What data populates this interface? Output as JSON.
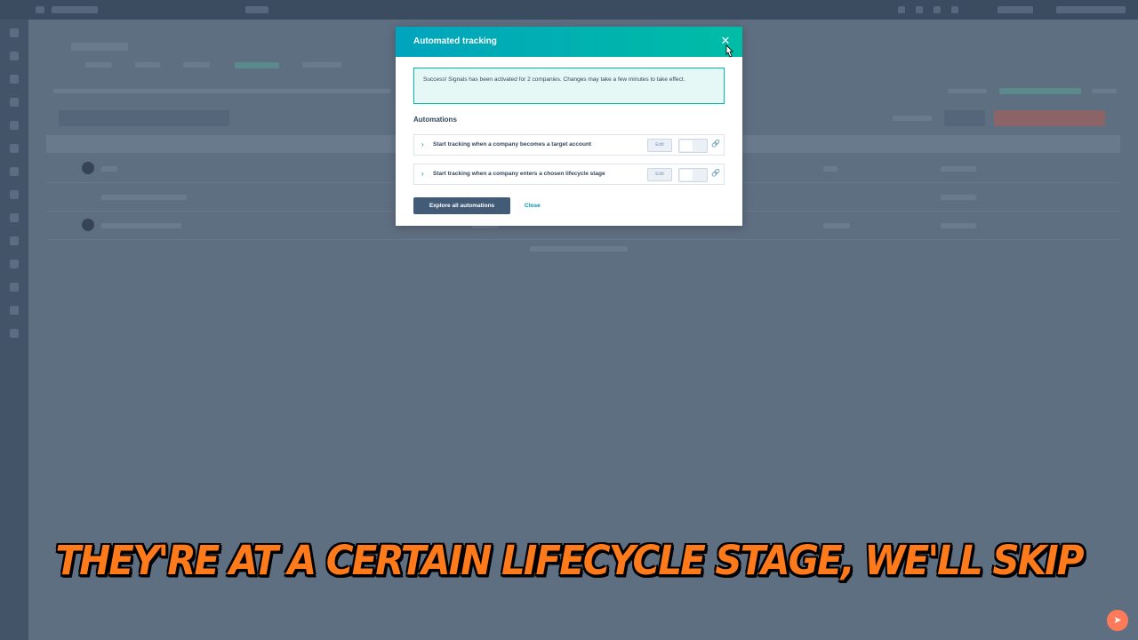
{
  "modal": {
    "title": "Automated tracking",
    "close_icon": "close-icon",
    "alert_text": "Success! Signals has been activated for 2 companies. Changes may take a few minutes to take effect.",
    "section_title": "Automations",
    "automations": [
      {
        "label": "Start tracking when a company becomes a target account",
        "edit_label": "Edit",
        "toggle_on": false
      },
      {
        "label": "Start tracking when a company enters a chosen lifecycle stage",
        "edit_label": "Edit",
        "toggle_on": false
      }
    ],
    "primary_button": "Explore all automations",
    "close_button": "Close"
  },
  "caption": "THEY'RE AT A CERTAIN LIFECYCLE STAGE, WE'LL SKIP",
  "colors": {
    "header_start": "#00a4bd",
    "header_end": "#00bda5",
    "primary_button": "#425b76",
    "caption": "#ff7a1a",
    "chat": "#ff7a59"
  }
}
